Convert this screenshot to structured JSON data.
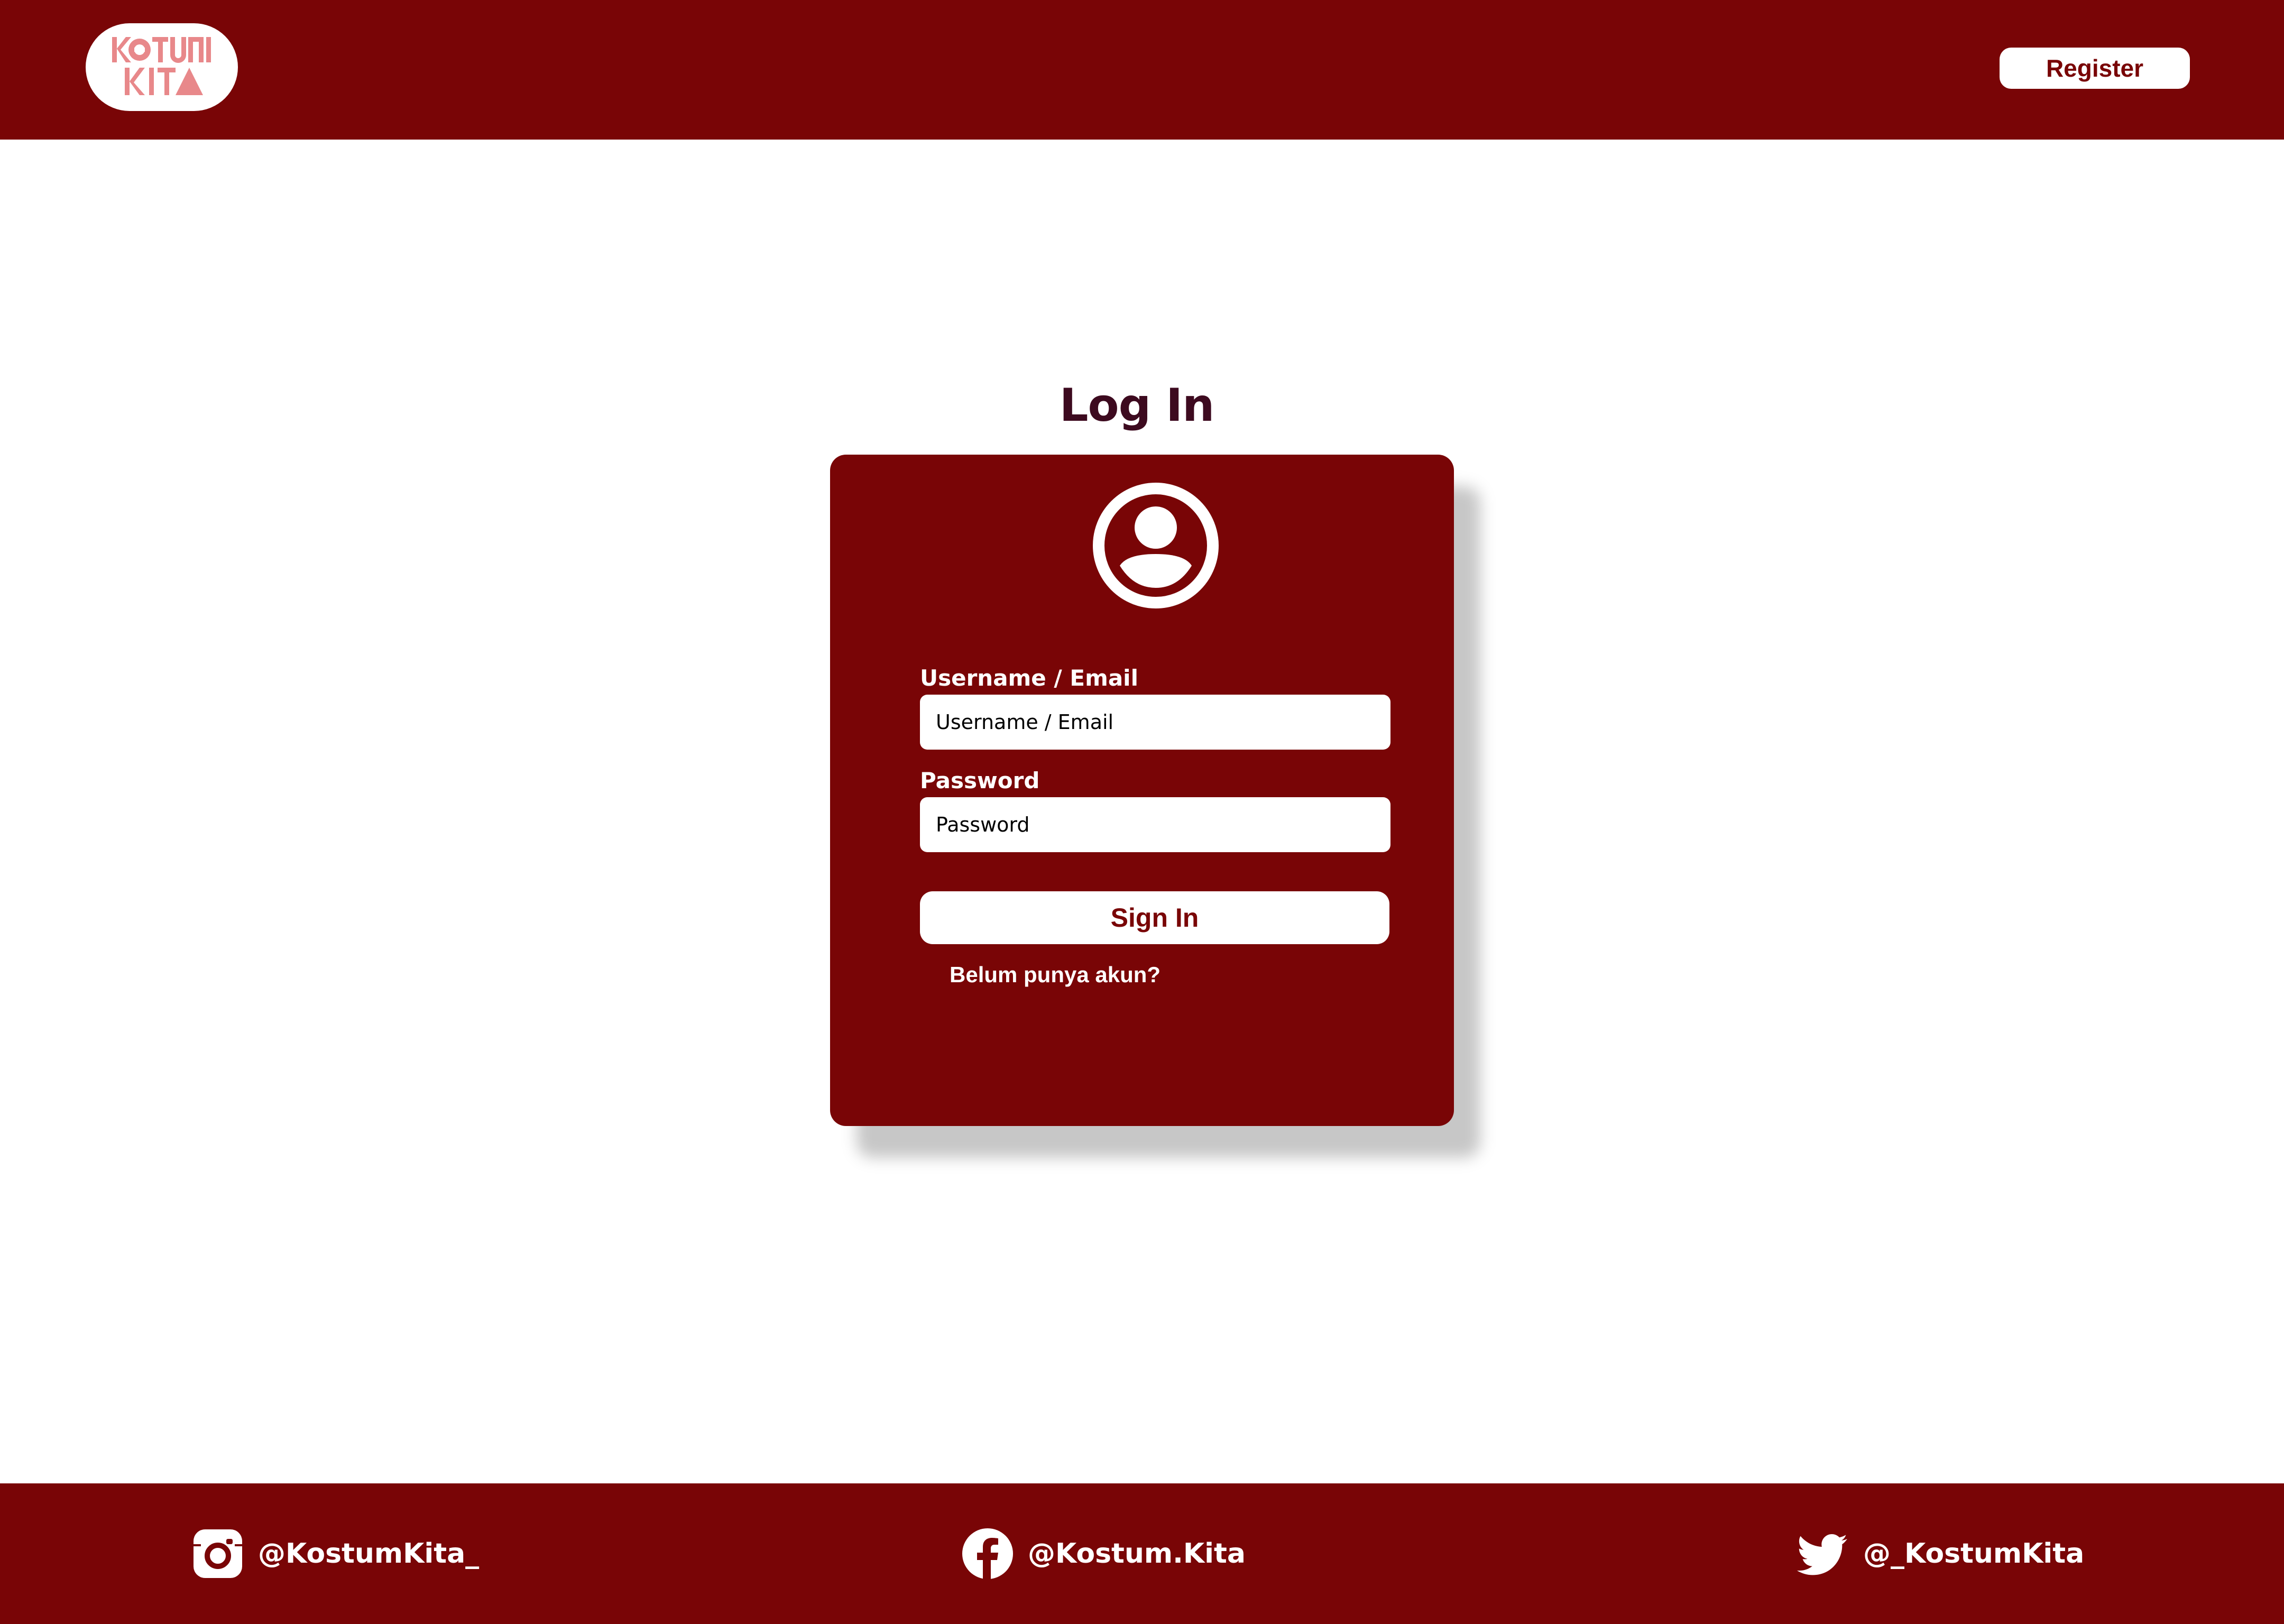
{
  "header": {
    "logo_lines": [
      "KOSTUM",
      "KITA"
    ],
    "register_label": "Register"
  },
  "login": {
    "title": "Log In",
    "avatar_icon": "user-circle-icon",
    "username": {
      "label": "Username / Email",
      "placeholder": "Username / Email",
      "value": ""
    },
    "password": {
      "label": "Password",
      "placeholder": "Password",
      "value": ""
    },
    "signin_label": "Sign In",
    "no_account_link": "Belum punya akun?"
  },
  "footer": {
    "socials": [
      {
        "network": "instagram",
        "icon": "instagram-icon",
        "handle": "@KostumKita_"
      },
      {
        "network": "facebook",
        "icon": "facebook-icon",
        "handle": "@Kostum.Kita"
      },
      {
        "network": "twitter",
        "icon": "twitter-icon",
        "handle": "@_KostumKita"
      }
    ]
  },
  "colors": {
    "brand_red": "#790506",
    "title_text": "#3d0a1f",
    "logo_pink": "#e8888a",
    "white": "#ffffff"
  }
}
